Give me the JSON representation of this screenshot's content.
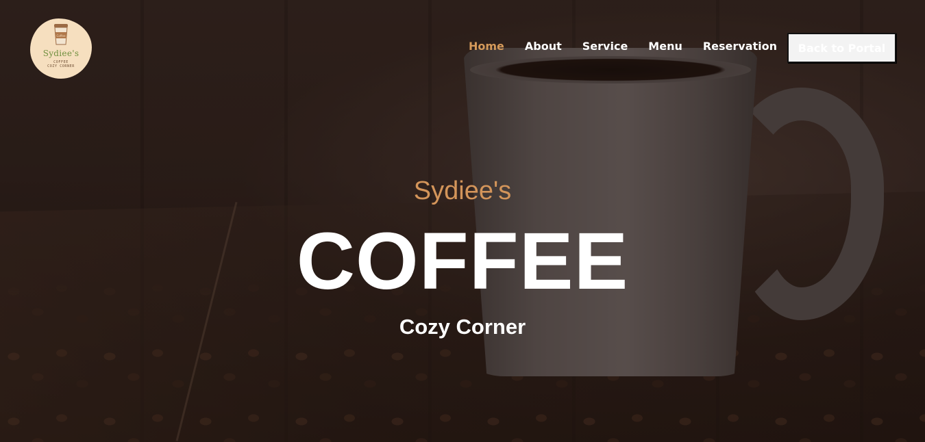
{
  "logo": {
    "title": "Sydiee's",
    "line1": "COFFEE",
    "line2": "COZY CORNER"
  },
  "nav": {
    "items": [
      {
        "label": "Home",
        "active": true
      },
      {
        "label": "About",
        "active": false
      },
      {
        "label": "Service",
        "active": false
      },
      {
        "label": "Menu",
        "active": false
      },
      {
        "label": "Reservation",
        "active": false
      }
    ],
    "portal_button": "Back to Portal"
  },
  "hero": {
    "brand": "Sydiee's",
    "title": "COFFEE",
    "subtitle": "Cozy Corner"
  },
  "colors": {
    "accent": "#d59a5a",
    "text": "#ffffff",
    "background": "#2a1c17",
    "logo_bg": "#f6dfbf",
    "logo_text": "#6f8f3e"
  }
}
